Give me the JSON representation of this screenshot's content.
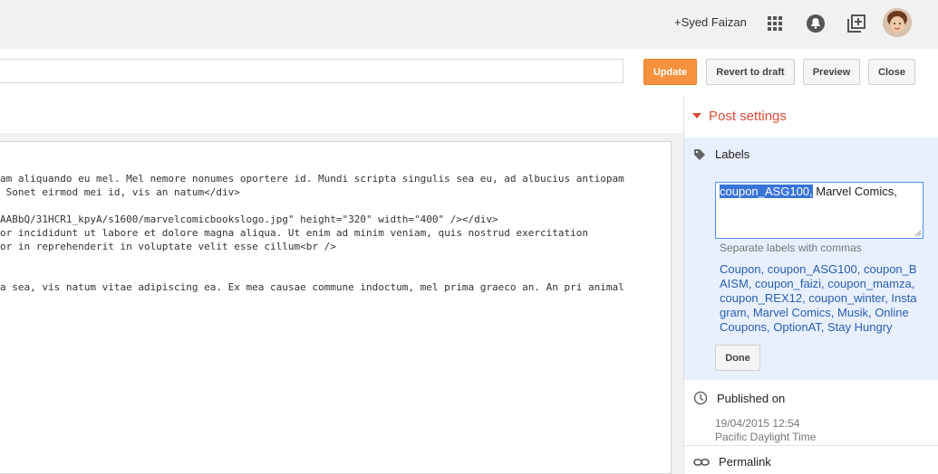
{
  "header": {
    "user_link": "+Syed Faizan",
    "icons": [
      "apps-grid-icon",
      "notifications-icon",
      "share-add-icon",
      "avatar"
    ]
  },
  "toolbar": {
    "title_value": "",
    "update_label": "Update",
    "revert_label": "Revert to draft",
    "preview_label": "Preview",
    "close_label": "Close"
  },
  "editor": {
    "lines": [
      "am aliquando eu mel. Mel nemore nonumes oportere id. Mundi scripta singulis sea eu, ad albucius antiopam",
      " Sonet eirmod mei id, vis an natum</div>",
      "",
      "AABbQ/31HCR1_kpyA/s1600/marvelcomicbookslogo.jpg\" height=\"320\" width=\"400\" /></div>",
      "or incididunt ut labore et dolore magna aliqua. Ut enim ad minim veniam, quis nostrud exercitation",
      "or in reprehenderit in voluptate velit esse cillum<br />",
      "",
      "",
      "a sea, vis natum vitae adipiscing ea. Ex mea causae commune indoctum, mel prima graeco an. An pri animal"
    ]
  },
  "sidebar": {
    "post_settings": "Post settings",
    "labels": {
      "title": "Labels",
      "selected": "coupon_ASG100,",
      "rest": " Marvel Comics,",
      "note": "Separate labels with commas",
      "suggestions_line1": "Coupon, coupon_ASG100, coupon_B",
      "suggestions_line2": "AISM, coupon_faizi, coupon_mamza,",
      "suggestions_line3": "coupon_REX12, coupon_winter, Insta",
      "suggestions_line4": "gram, Marvel Comics, Musik, Online",
      "suggestions_line5": "Coupons, OptionAT, Stay Hungry",
      "done_label": "Done"
    },
    "published": {
      "title": "Published on",
      "date": "19/04/2015 12:54",
      "timezone": "Pacific Daylight Time"
    },
    "permalink": "Permalink"
  },
  "colors": {
    "accent_orange": "#f6913d",
    "link_blue": "#2a5db0",
    "post_settings_red": "#dd4b39",
    "labels_panel_bg": "#e8f0fe"
  }
}
